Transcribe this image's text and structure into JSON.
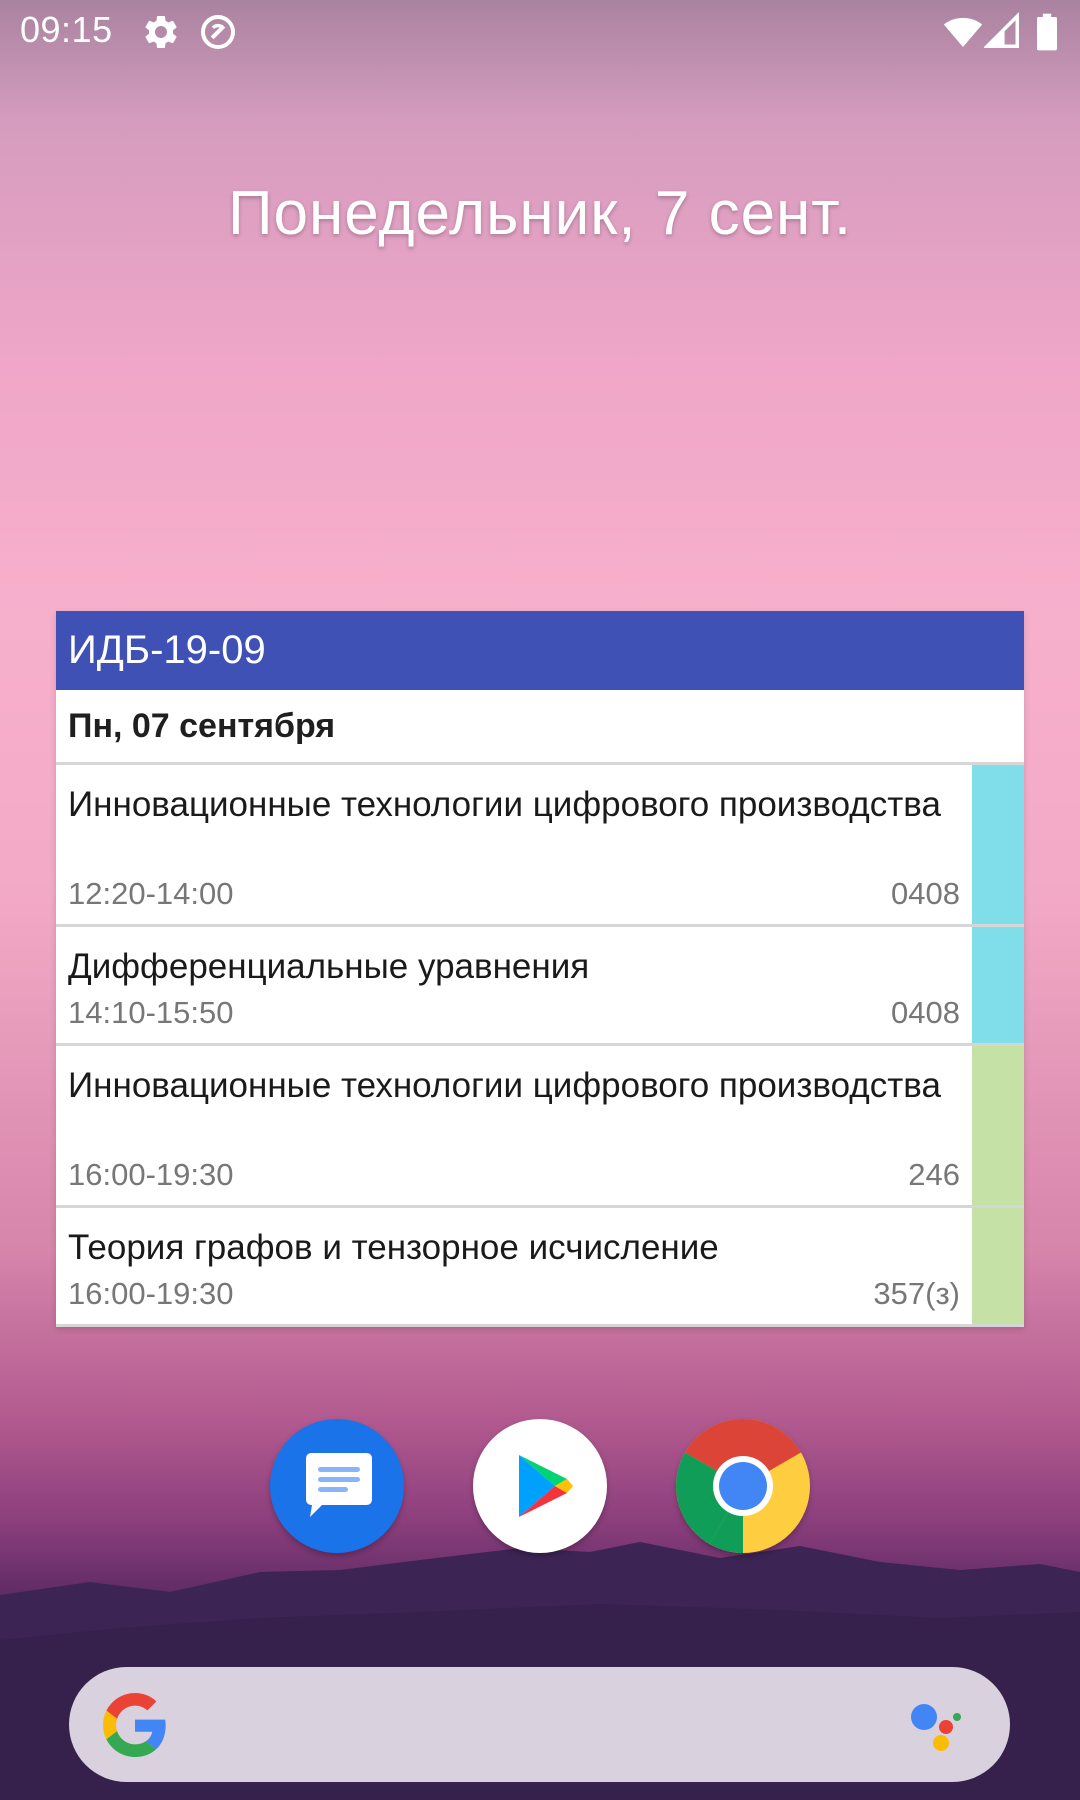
{
  "status_bar": {
    "time": "09:15",
    "left_icons": [
      "gear-icon",
      "do-not-disturb-icon"
    ],
    "right_icons": [
      "wifi-icon",
      "cellular-signal-icon",
      "battery-icon"
    ]
  },
  "home": {
    "date": "Понедельник, 7 сент."
  },
  "widget": {
    "group": "ИДБ-19-09",
    "day": "Пн, 07 сентября",
    "lessons": [
      {
        "title": "Инновационные технологии цифрового производства",
        "time": "12:20-14:00",
        "room": "0408",
        "color": "#80deea"
      },
      {
        "title": "Дифференциальные уравнения",
        "time": "14:10-15:50",
        "room": "0408",
        "color": "#80deea"
      },
      {
        "title": "Инновационные технологии цифрового производства",
        "time": "16:00-19:30",
        "room": "246",
        "color": "#c5e1a5"
      },
      {
        "title": "Теория графов и тензорное исчисление",
        "time": "16:00-19:30",
        "room": "357(з)",
        "color": "#c5e1a5"
      }
    ]
  },
  "dock": [
    {
      "name": "Messages",
      "icon": "messages-icon",
      "color": "#1a73e8"
    },
    {
      "name": "Play Store",
      "icon": "play-store-icon",
      "color": "#ffffff"
    },
    {
      "name": "Chrome",
      "icon": "chrome-icon",
      "color": "#4285f4"
    }
  ],
  "search_bar": {
    "left_icon": "google-logo-icon",
    "right_icon": "google-assistant-icon"
  }
}
